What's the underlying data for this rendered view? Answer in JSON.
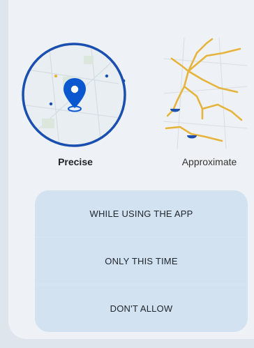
{
  "location_options": {
    "precise": {
      "label": "Precise",
      "icon": "map-pin-icon",
      "selected": true
    },
    "approximate": {
      "label": "Approximate",
      "icon": "approximate-map-icon",
      "selected": false
    }
  },
  "actions": [
    {
      "label": "WHILE USING THE APP"
    },
    {
      "label": "ONLY THIS TIME"
    },
    {
      "label": "DON'T ALLOW"
    }
  ],
  "colors": {
    "accent": "#1a4fb0",
    "pin": "#0b57d0",
    "road": "#e6b43c",
    "button": "#d3e2f0",
    "background": "#eef2f6"
  }
}
